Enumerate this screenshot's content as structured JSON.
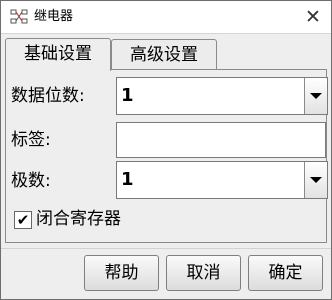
{
  "window": {
    "title": "继电器",
    "icon": "relay-app-icon",
    "close_glyph": "✕"
  },
  "tabs": [
    {
      "label": "基础设置",
      "active": true
    },
    {
      "label": "高级设置",
      "active": false
    }
  ],
  "form": {
    "data_bits": {
      "label": "数据位数:",
      "value": "1"
    },
    "tag": {
      "label": "标签:",
      "value": ""
    },
    "poles": {
      "label": "极数:",
      "value": "1"
    },
    "closed_register": {
      "label": "闭合寄存器",
      "checked": true,
      "glyph": "✔"
    }
  },
  "buttons": {
    "help": "帮助",
    "cancel": "取消",
    "ok": "确定"
  }
}
